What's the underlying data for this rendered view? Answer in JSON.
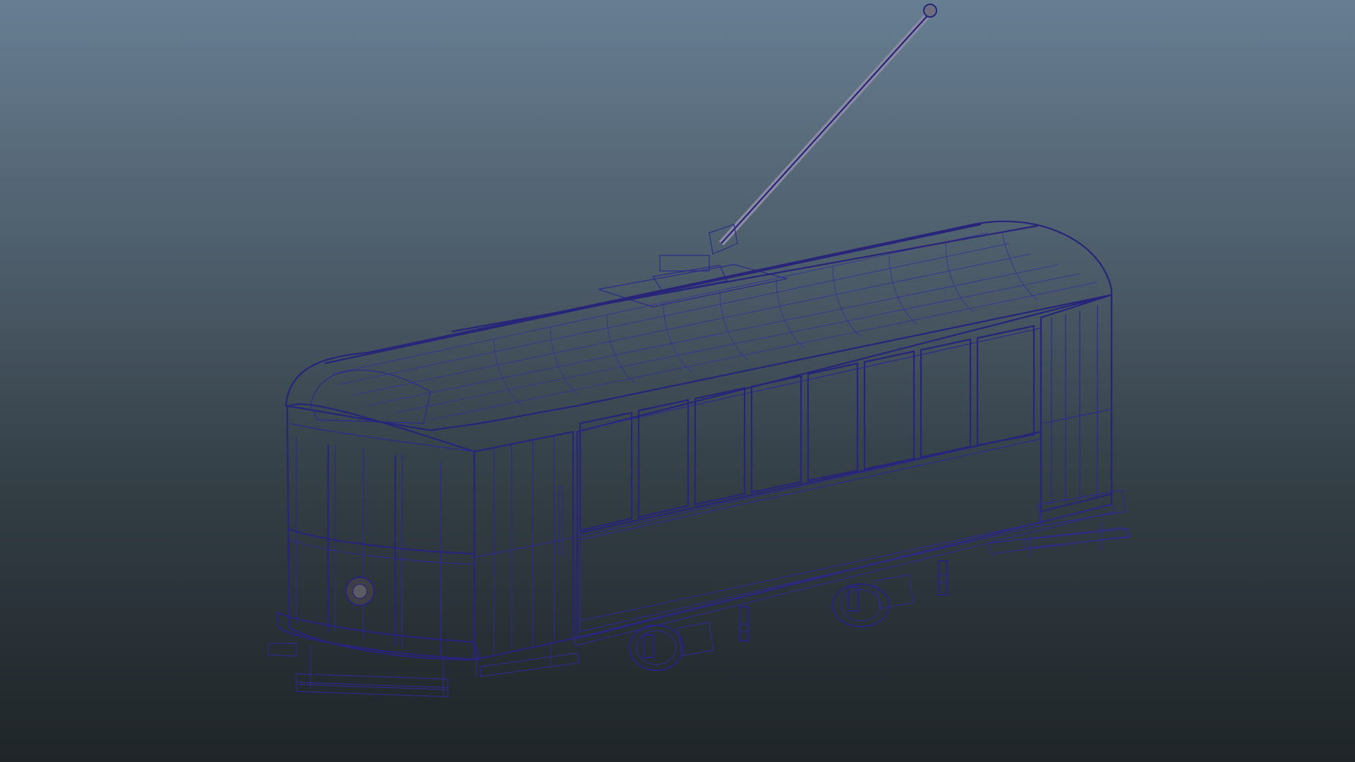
{
  "viewport": {
    "mode": "wireframe-on-shaded",
    "background_top": "#677e92",
    "background_bottom": "#1f2528",
    "wire_color": "#2d2a8a",
    "surface_color": "#8a8a8a"
  },
  "scene": {
    "object": "trolley-car-mesh"
  }
}
